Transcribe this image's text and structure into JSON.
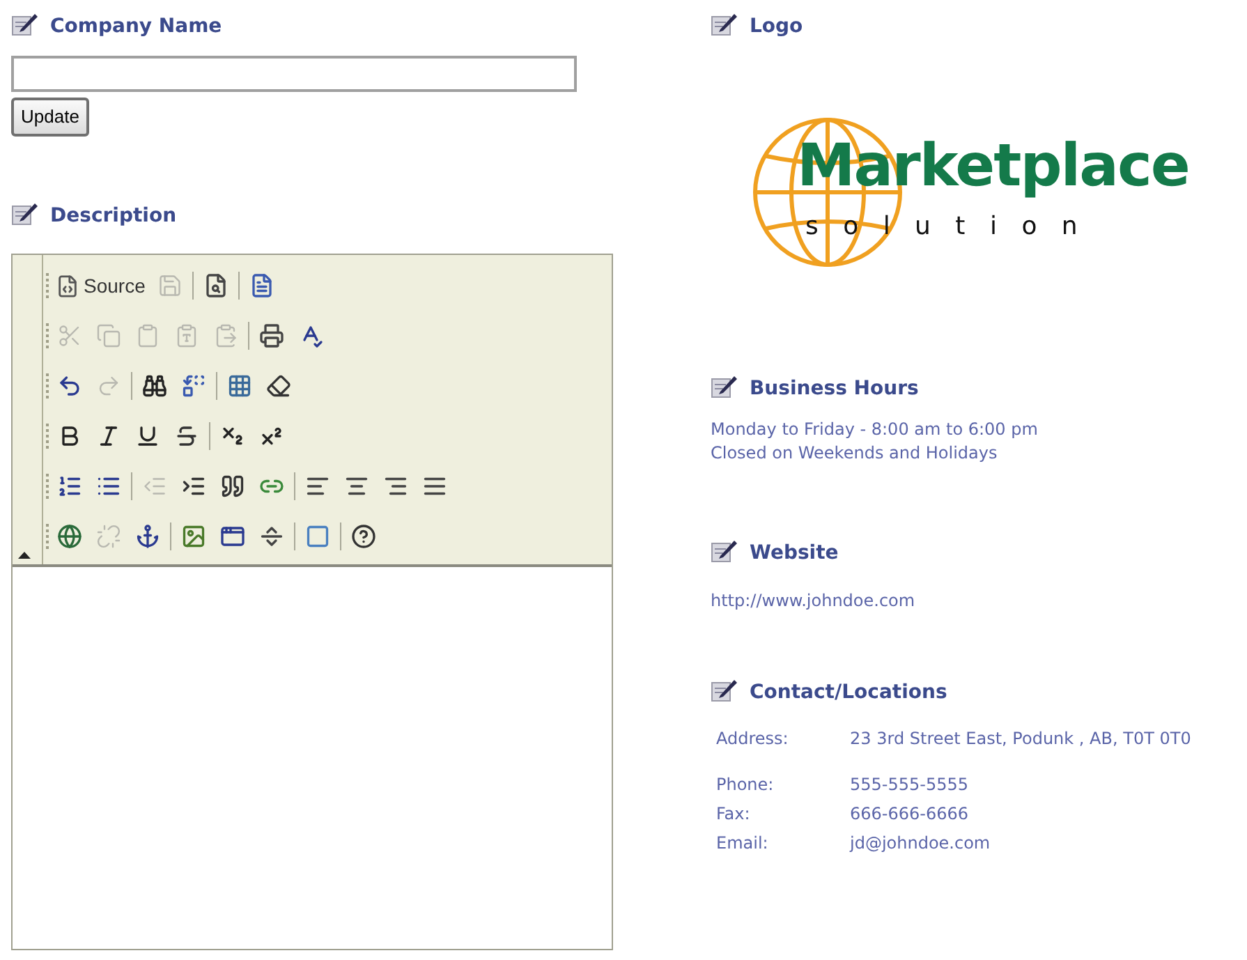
{
  "company_name": {
    "heading": "Company Name",
    "button": "Update"
  },
  "description": {
    "heading": "Description",
    "toolbar": [
      {
        "groups": [
          {
            "buttons": [
              {
                "label": "Source",
                "disabled": false
              },
              {
                "disabled": true
              }
            ]
          },
          {
            "buttons": [
              {
                "disabled": false
              }
            ]
          },
          {
            "buttons": [
              {
                "disabled": false
              }
            ]
          }
        ]
      },
      {
        "groups": [
          {
            "buttons": [
              {
                "disabled": true
              },
              {
                "disabled": true
              },
              {
                "disabled": true
              },
              {
                "disabled": true
              },
              {
                "disabled": true
              }
            ]
          },
          {
            "buttons": [
              {
                "disabled": false
              },
              {
                "disabled": false
              }
            ]
          }
        ]
      },
      {
        "groups": [
          {
            "buttons": [
              {
                "disabled": false
              },
              {
                "disabled": true
              }
            ]
          },
          {
            "buttons": [
              {
                "disabled": false
              },
              {
                "disabled": false
              }
            ]
          },
          {
            "buttons": [
              {
                "disabled": false
              },
              {
                "disabled": false
              }
            ]
          }
        ]
      },
      {
        "groups": [
          {
            "buttons": [
              {
                "disabled": false
              },
              {
                "disabled": false
              },
              {
                "disabled": false
              },
              {
                "disabled": false
              }
            ]
          },
          {
            "buttons": [
              {
                "disabled": false
              },
              {
                "disabled": false
              }
            ]
          }
        ]
      },
      {
        "groups": [
          {
            "buttons": [
              {
                "disabled": false
              },
              {
                "disabled": false
              }
            ]
          },
          {
            "buttons": [
              {
                "disabled": true
              },
              {
                "disabled": false
              },
              {
                "disabled": false
              },
              {
                "disabled": false
              }
            ]
          },
          {
            "buttons": [
              {
                "disabled": false
              },
              {
                "disabled": false
              },
              {
                "disabled": false
              },
              {
                "disabled": false
              }
            ]
          }
        ]
      },
      {
        "groups": [
          {
            "buttons": [
              {
                "disabled": false
              },
              {
                "disabled": true
              },
              {
                "disabled": false
              }
            ]
          },
          {
            "buttons": [
              {
                "disabled": false
              },
              {
                "disabled": false
              },
              {
                "disabled": false
              }
            ]
          },
          {
            "buttons": [
              {
                "disabled": false
              }
            ]
          },
          {
            "buttons": [
              {
                "disabled": false
              }
            ]
          }
        ]
      }
    ]
  },
  "logo": {
    "heading": "Logo",
    "title": "Marketplace",
    "subtitle": "s o l u t i o n"
  },
  "business_hours": {
    "heading": "Business Hours",
    "lines": [
      "Monday to Friday - 8:00 am to 6:00 pm",
      "Closed on Weekends and Holidays"
    ]
  },
  "website": {
    "heading": "Website",
    "url": "http://www.johndoe.com"
  },
  "contact": {
    "heading": "Contact/Locations",
    "rows": [
      {
        "label": "Address:",
        "value": "23 3rd Street East, Podunk , AB, T0T 0T0"
      },
      {
        "label": "Phone:",
        "value": "555-555-5555"
      },
      {
        "label": "Fax:",
        "value": "666-666-6666"
      },
      {
        "label": "Email:",
        "value": "jd@johndoe.com"
      }
    ]
  }
}
